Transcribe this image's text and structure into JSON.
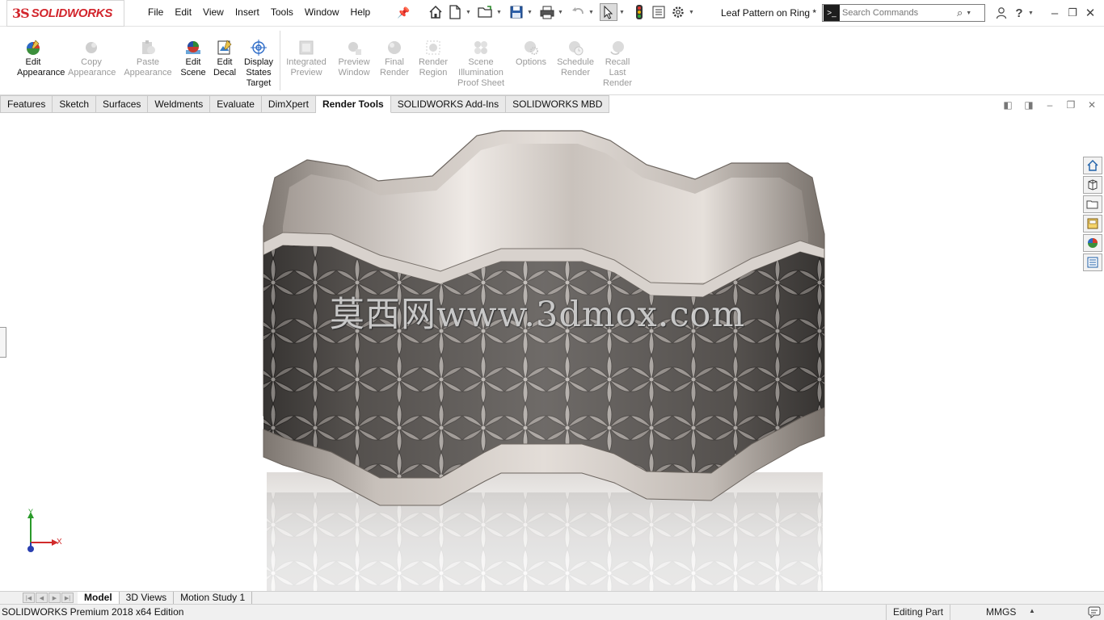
{
  "app": {
    "logo_prefix": "3S",
    "logo_text": "SOLIDWORKS",
    "document_title": "Leaf Pattern on Ring *"
  },
  "menu": [
    "File",
    "Edit",
    "View",
    "Insert",
    "Tools",
    "Window",
    "Help"
  ],
  "search": {
    "placeholder": "Search Commands"
  },
  "ribbon": {
    "edit_appearance": "Edit Appearance",
    "copy_appearance": "Copy Appearance",
    "paste_appearance": "Paste Appearance",
    "edit_scene": "Edit Scene",
    "edit_decal": "Edit Decal",
    "display_states_target": "Display States Target",
    "integrated_preview": "Integrated Preview",
    "preview_window": "Preview Window",
    "final_render": "Final Render",
    "render_region": "Render Region",
    "scene_illumination": "Scene Illumination Proof Sheet",
    "options": "Options",
    "schedule_render": "Schedule Render",
    "recall_last_render": "Recall Last Render"
  },
  "command_tabs": [
    "Features",
    "Sketch",
    "Surfaces",
    "Weldments",
    "Evaluate",
    "DimXpert",
    "Render Tools",
    "SOLIDWORKS Add-Ins",
    "SOLIDWORKS MBD"
  ],
  "active_command_tab": "Render Tools",
  "viewport": {
    "watermark": "莫西网www.3dmox.com",
    "triad_x": "X",
    "triad_y": "Y"
  },
  "model_tabs": [
    "Model",
    "3D Views",
    "Motion Study 1"
  ],
  "active_model_tab": "Model",
  "status": {
    "edition": "SOLIDWORKS Premium 2018 x64 Edition",
    "mode": "Editing Part",
    "units": "MMGS"
  },
  "colors": {
    "brand_red": "#d2252c",
    "accent_blue": "#2c6bc7",
    "ring_metal": "#b9b2ac"
  }
}
